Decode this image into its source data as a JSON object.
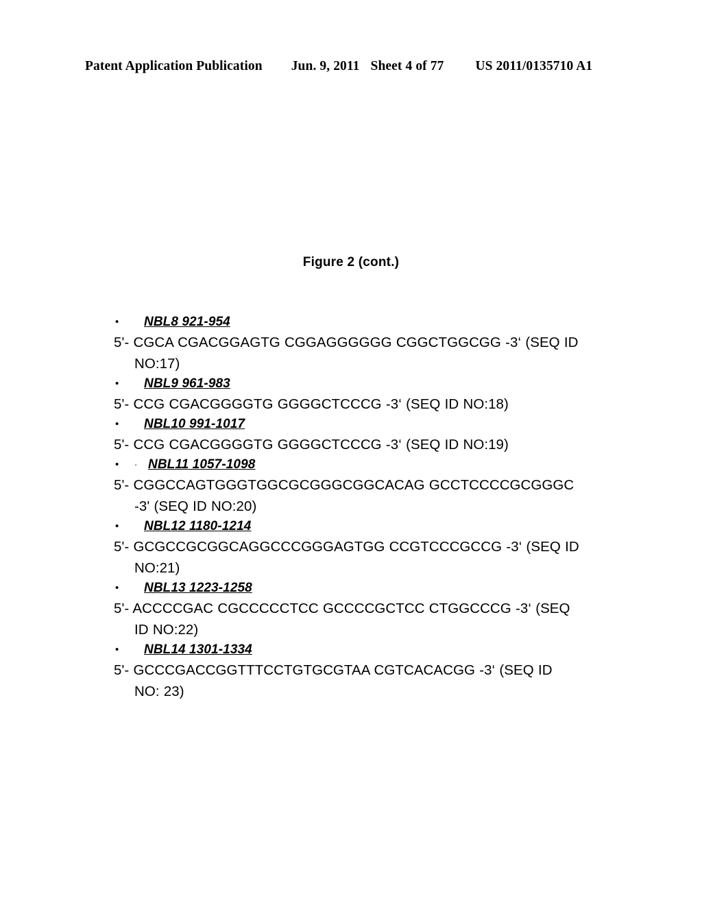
{
  "header": {
    "publication": "Patent Application Publication",
    "date": "Jun. 9, 2011",
    "sheet": "Sheet 4 of 77",
    "doc_number": "US 2011/0135710 A1"
  },
  "figure": {
    "title": "Figure 2 (cont.)"
  },
  "bullet_glyph": "•",
  "stray_dot_glyph": "·",
  "entries": [
    {
      "label": "NBL8 921-954",
      "line1": "5'- CGCA CGACGGAGTG CGGAGGGGGG CGGCTGGCGG -3‘ (SEQ ID",
      "line2": "NO:17)",
      "stray_dot": false
    },
    {
      "label": "NBL9 961-983",
      "line1": "5'- CCG CGACGGGGTG GGGGCTCCCG -3‘ (SEQ ID NO:18)",
      "line2": "",
      "stray_dot": false
    },
    {
      "label": "NBL10 991-1017",
      "line1": "5'- CCG CGACGGGGTG GGGGCTCCCG -3‘ (SEQ ID NO:19)",
      "line2": "",
      "stray_dot": false
    },
    {
      "label": "NBL11 1057-1098",
      "line1": "5'- CGGCCAGTGGGTGGCGCGGGCGGCACAG GCCTCCCCGCGGGC",
      "line2": "-3' (SEQ ID NO:20)",
      "stray_dot": true
    },
    {
      "label": "NBL12 1180-1214",
      "line1": "5'- GCGCCGCGGCAGGCCCGGGAGTGG CCGTCCCGCCG -3‘ (SEQ ID",
      "line2": "NO:21)",
      "stray_dot": false
    },
    {
      "label": "NBL13 1223-1258",
      "line1": "5'- ACCCCGAC CGCCCCCTCC GCCCCGCTCC CTGGCCCG -3‘ (SEQ",
      "line2": "ID NO:22)",
      "stray_dot": false
    },
    {
      "label": "NBL14 1301-1334",
      "line1": "5'- GCCCGACCGGTTTCCTGTGCGTAA CGTCACACGG -3‘ (SEQ ID",
      "line2": "NO: 23)",
      "stray_dot": false
    }
  ]
}
